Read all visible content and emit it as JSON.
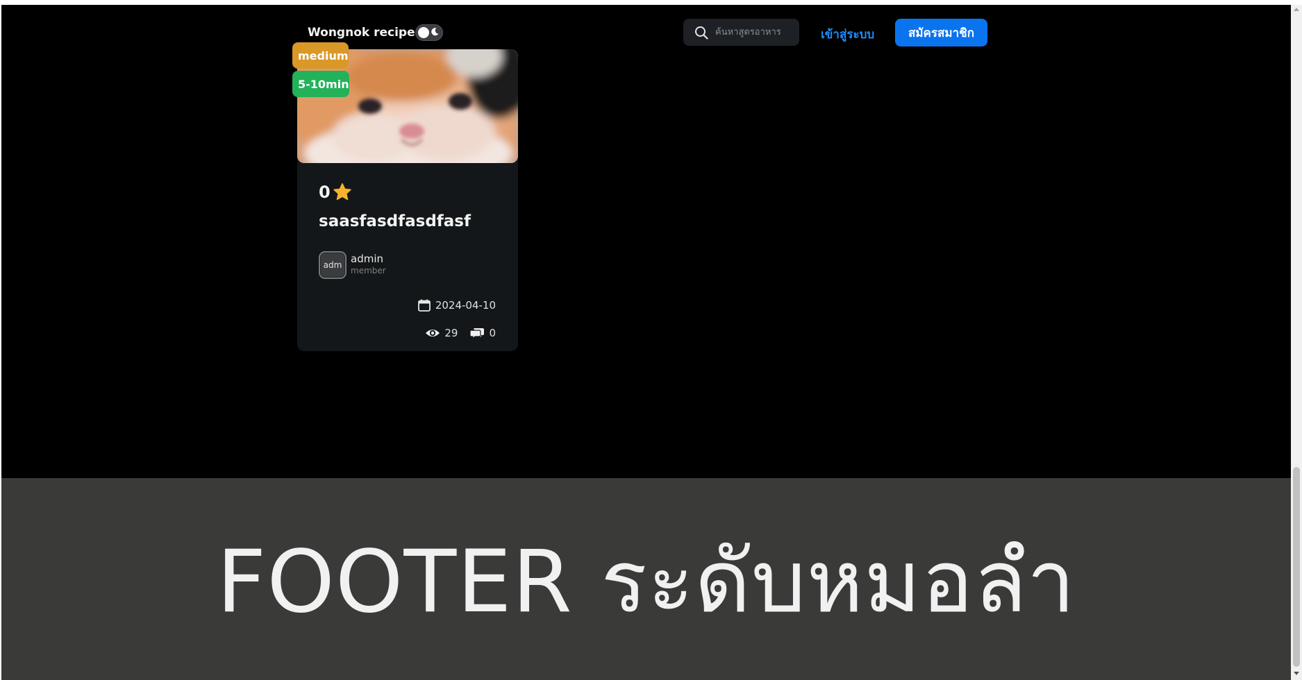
{
  "header": {
    "brand": "Wongnok recipes",
    "search_placeholder": "ค้นหาสูตรอาหาร",
    "login_label": "เข้าสู่ระบบ",
    "signup_label": "สมัครสมาชิก"
  },
  "recipe_card": {
    "difficulty": "medium",
    "time": "5-10min",
    "rating": "0",
    "title": "saasfasdfasdfasf",
    "author": {
      "avatar_text": "adm",
      "name": "admin",
      "role": "member"
    },
    "date": "2024-04-10",
    "views": "29",
    "comments": "0"
  },
  "footer": {
    "text": "FOOTER ระดับหมอลำ"
  },
  "colors": {
    "accent": "#0a74ee",
    "link": "#1a8cff",
    "difficulty_badge": "#d99827",
    "time_badge": "#23b25a",
    "star": "#f5b32e",
    "footer_bg": "#3a3a39"
  },
  "icons": {
    "theme": "moon-icon",
    "search": "search-icon",
    "rating": "star-icon",
    "date": "calendar-icon",
    "views": "eye-icon",
    "comments": "chat-bubbles-icon"
  }
}
